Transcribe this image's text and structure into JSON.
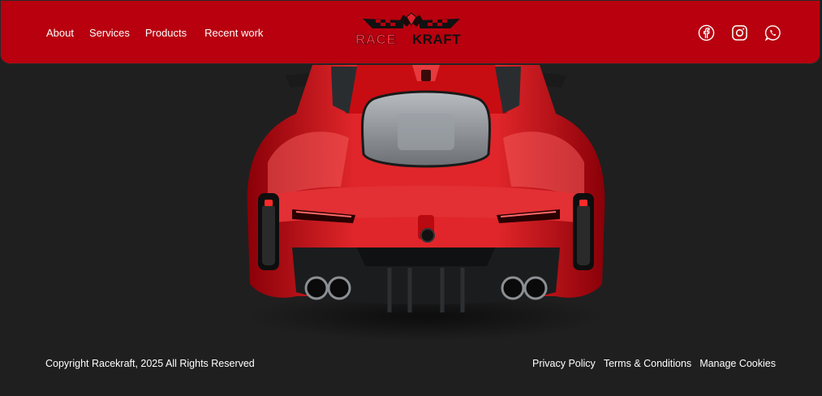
{
  "nav": {
    "items": [
      {
        "label": "About"
      },
      {
        "label": "Services"
      },
      {
        "label": "Products"
      },
      {
        "label": "Recent work"
      }
    ]
  },
  "brand": {
    "logo_text_part1": "RACE",
    "logo_text_part2": "KRAFT",
    "primary_color": "#b8000f",
    "background_color": "#1f1f1f"
  },
  "socials": [
    {
      "icon": "facebook-icon"
    },
    {
      "icon": "instagram-icon"
    },
    {
      "icon": "whatsapp-icon"
    }
  ],
  "hero": {
    "image": "red-sports-car-rear-view",
    "car_color": "#d40f14"
  },
  "footer": {
    "copyright": "Copyright Racekraft, 2025 All Rights Reserved",
    "links": [
      {
        "label": "Privacy Policy"
      },
      {
        "label": "Terms & Conditions"
      },
      {
        "label": "Manage Cookies"
      }
    ]
  }
}
